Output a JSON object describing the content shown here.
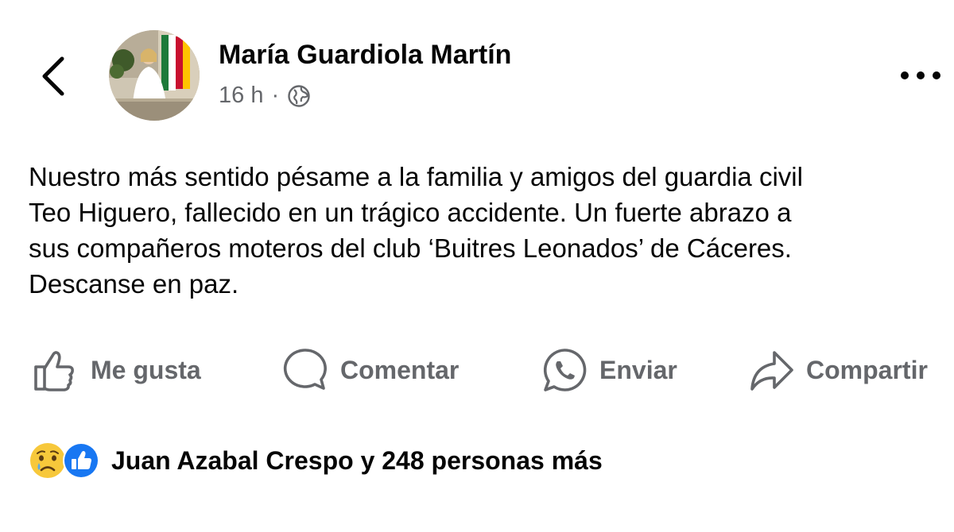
{
  "post": {
    "author_name": "María Guardiola Martín",
    "time_ago": "16 h",
    "separator": "·",
    "visibility_icon": "globe-icon",
    "text": "Nuestro más sentido pésame a la familia y amigos  del guardia civil\nTeo Higuero, fallecido en un trágico accidente. Un fuerte abrazo a\nsus compañeros moteros del club ‘Buitres Leonados’ de Cáceres.\nDescanse en paz."
  },
  "nav": {
    "back_icon": "chevron-left-icon",
    "more_icon": "more-horizontal-icon"
  },
  "actions": {
    "like_label": "Me gusta",
    "comment_label": "Comentar",
    "send_label": "Enviar",
    "share_label": "Compartir"
  },
  "reactions": {
    "icons": [
      "sad-reaction-icon",
      "like-reaction-icon"
    ],
    "summary": "Juan Azabal Crespo y 248 personas más"
  },
  "colors": {
    "text_primary": "#050505",
    "text_secondary": "#65676b",
    "like_blue": "#1877f2",
    "sad_yellow": "#f7c83b"
  }
}
